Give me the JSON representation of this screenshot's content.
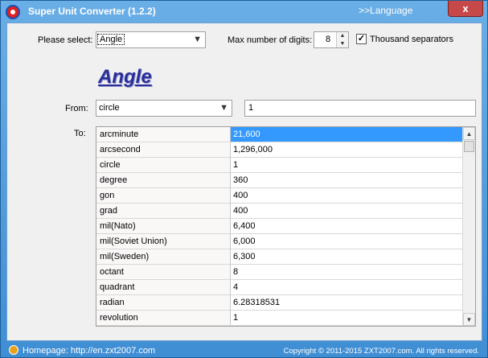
{
  "window": {
    "title": "Super Unit Converter (1.2.2)",
    "language_label": ">>Language",
    "close_glyph": "x"
  },
  "controls": {
    "select_label": "Please select:",
    "category_value": "Angle",
    "max_digits_label": "Max number of digits:",
    "max_digits_value": "8",
    "thousand_separators_label": "Thousand separators",
    "thousand_separators_checked": true
  },
  "heading": "Angle",
  "from": {
    "label": "From:",
    "unit": "circle",
    "value": "1"
  },
  "to": {
    "label": "To:",
    "rows": [
      {
        "unit": "arcminute",
        "value": "21,600",
        "selected": true
      },
      {
        "unit": "arcsecond",
        "value": "1,296,000"
      },
      {
        "unit": "circle",
        "value": "1"
      },
      {
        "unit": "degree",
        "value": "360"
      },
      {
        "unit": "gon",
        "value": "400"
      },
      {
        "unit": "grad",
        "value": "400"
      },
      {
        "unit": "mil(Nato)",
        "value": "6,400"
      },
      {
        "unit": "mil(Soviet Union)",
        "value": "6,000"
      },
      {
        "unit": "mil(Sweden)",
        "value": "6,300"
      },
      {
        "unit": "octant",
        "value": "8"
      },
      {
        "unit": "quadrant",
        "value": "4"
      },
      {
        "unit": "radian",
        "value": "6.28318531"
      },
      {
        "unit": "revolution",
        "value": "1"
      }
    ]
  },
  "status": {
    "homepage": "Homepage: http://en.zxt2007.com",
    "copyright": "Copyright © 2011-2015 ZXT2007.com. All rights reserved."
  },
  "colors": {
    "selection": "#3399ff",
    "heading": "#2a2f9a",
    "frame": "#3f8ed4"
  }
}
